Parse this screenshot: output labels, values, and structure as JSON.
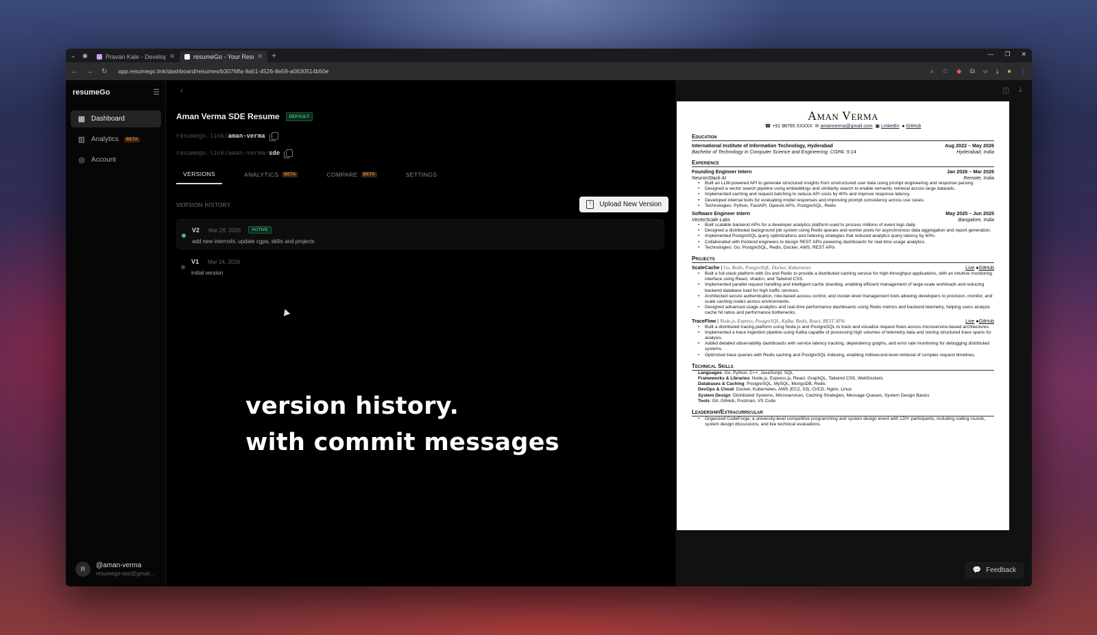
{
  "browser": {
    "tabs": [
      {
        "title": "Pravan Kale - Developer",
        "favicon_color": "#c9a0ff"
      },
      {
        "title": "resumeGo - Your Resume",
        "favicon_color": "#ffffff"
      }
    ],
    "url": "app.resumego.link/dashboard/resumes/b3076ffa-9a51-4526-8e59-a0630514b50e"
  },
  "sidebar": {
    "brand": "resumeGo",
    "items": [
      {
        "label": "Dashboard",
        "icon": "grid-icon"
      },
      {
        "label": "Analytics",
        "icon": "bar-chart-icon",
        "badge": "BETA"
      },
      {
        "label": "Account",
        "icon": "user-circle-icon"
      }
    ],
    "user": {
      "initial": "R",
      "handle": "@aman-verma",
      "email": "resumego-test@gmail..."
    }
  },
  "main": {
    "title": "Aman Verma SDE Resume",
    "default_badge": "DEFAULT",
    "link1_prefix": "resumego.link/",
    "link1_slug": "aman-verma",
    "link2_prefix": "resumego.link/aman-verma/",
    "link2_slug": "sde",
    "tabs": [
      {
        "label": "VERSIONS"
      },
      {
        "label": "ANALYTICS",
        "badge": "BETA"
      },
      {
        "label": "COMPARE",
        "badge": "BETA"
      },
      {
        "label": "SETTINGS"
      }
    ],
    "version_history_label": "VERSION HISTORY",
    "upload_label": "Upload New Version",
    "versions": [
      {
        "name": "V2",
        "date": "Mar 29, 2026",
        "status": "ACTIVE",
        "message": "add new internshi, update cgpa, skills and projects"
      },
      {
        "name": "V1",
        "date": "Mar 14, 2026",
        "message": "initial version"
      }
    ],
    "caption_line1": "version history.",
    "caption_line2": "with commit messages"
  },
  "resume": {
    "name": "Aman Verma",
    "phone": "+91 98765 XXXXX",
    "email": "amanverma@gmail.com",
    "linkedin": "LinkedIn",
    "github": "GitHub",
    "sec_education": "Education",
    "edu_school": "International Institute of Information Technology, Hyderabad",
    "edu_dates": "Aug 2022 – May 2026",
    "edu_degree": "Bachelor of Technology in Computer Science and Engineering, CGPA: 9.14",
    "edu_loc": "Hyderabad, India",
    "sec_experience": "Experience",
    "exp1_role": "Founding Engineer Intern",
    "exp1_dates": "Jan 2026 – Mar 2026",
    "exp1_company": "NeuronStack AI",
    "exp1_loc": "Remote, India",
    "exp1_bullets": [
      "Built an LLM-powered API to generate structured insights from unstructured user data using prompt engineering and response parsing.",
      "Designed a vector search pipeline using embeddings and similarity search to enable semantic retrieval across large datasets.",
      "Implemented caching and request batching to reduce API costs by 40% and improve response latency.",
      "Developed internal tools for evaluating model responses and improving prompt consistency across use cases.",
      "Technologies: Python, FastAPI, OpenAI APIs, PostgreSQL, Redis"
    ],
    "exp2_role": "Software Engineer Intern",
    "exp2_dates": "May 2025 – Jun 2025",
    "exp2_company": "VectorScale Labs",
    "exp2_loc": "Bangalore, India",
    "exp2_bullets": [
      "Built scalable backend APIs for a developer analytics platform used to process millions of event logs daily.",
      "Designed a distributed background job system using Redis queues and worker pools for asynchronous data aggregation and report generation.",
      "Implemented PostgreSQL query optimizations and indexing strategies that reduced analytics query latency by 60%.",
      "Collaborated with frontend engineers to design REST APIs powering dashboards for real-time usage analytics.",
      "Technologies: Go, PostgreSQL, Redis, Docker, AWS, REST APIs"
    ],
    "sec_projects": "Projects",
    "p1_name": "ScaleCache",
    "p1_tech": "Go, Redis, PostgreSQL, Docker, Kubernetes",
    "p1_live": "Live",
    "p1_gh": "GitHub",
    "p1_bullets": [
      "Built a full-stack platform with Go and Redis to provide a distributed caching service for high-throughput applications, with an intuitive monitoring interface using React, shadcn, and Tailwind CSS.",
      "Implemented parallel request handling and intelligent cache sharding, enabling efficient management of large-scale workloads and reducing backend database load for high traffic services.",
      "Architected secure authentication, role-based access control, and cluster-level management tools allowing developers to provision, monitor, and scale caching nodes across environments.",
      "Designed advanced usage analytics and real-time performance dashboards using Redis metrics and backend telemetry, helping users analyze cache hit ratios and performance bottlenecks."
    ],
    "p2_name": "TraceFlow",
    "p2_tech": "Node.js, Express, PostgreSQL, Kafka, Redis, React, REST APIs",
    "p2_live": "Live",
    "p2_gh": "GitHub",
    "p2_bullets": [
      "Built a distributed tracing platform using Node.js and PostgreSQL to track and visualize request flows across microservice-based architectures.",
      "Implemented a trace ingestion pipeline using Kafka capable of processing high volumes of telemetry data and storing structured trace spans for analysis.",
      "Added detailed observability dashboards with service latency tracking, dependency graphs, and error rate monitoring for debugging distributed systems.",
      "Optimized trace queries with Redis caching and PostgreSQL indexing, enabling millisecond-level retrieval of complex request timelines."
    ],
    "sec_skills": "Technical Skills",
    "skills": [
      {
        "k": "Languages",
        "v": "Go, Python, C++, JavaScript, SQL"
      },
      {
        "k": "Frameworks & Libraries",
        "v": "Node.js, Express.js, React, GraphQL, Tailwind CSS, WebSockets"
      },
      {
        "k": "Databases & Caching",
        "v": "PostgreSQL, MySQL, MongoDB, Redis"
      },
      {
        "k": "DevOps & Cloud",
        "v": "Docker, Kubernetes, AWS (EC2, S3), CI/CD, Nginx, Linux"
      },
      {
        "k": "System Design",
        "v": "Distributed Systems, Microservices, Caching Strategies, Message Queues, System Design Basics"
      },
      {
        "k": "Tools",
        "v": "Git, GitHub, Postman, VS Code"
      }
    ],
    "sec_leadership": "Leadership/Extracurricular",
    "lead_bullets": [
      "Organized CodeForge, a university-level competitive programming and system design event with 120+ participants, including coding rounds, system design discussions, and live technical evaluations."
    ]
  },
  "feedback_label": "Feedback",
  "colors": {
    "accent_green": "#3cc27a",
    "beta_orange": "#e08a3a"
  }
}
